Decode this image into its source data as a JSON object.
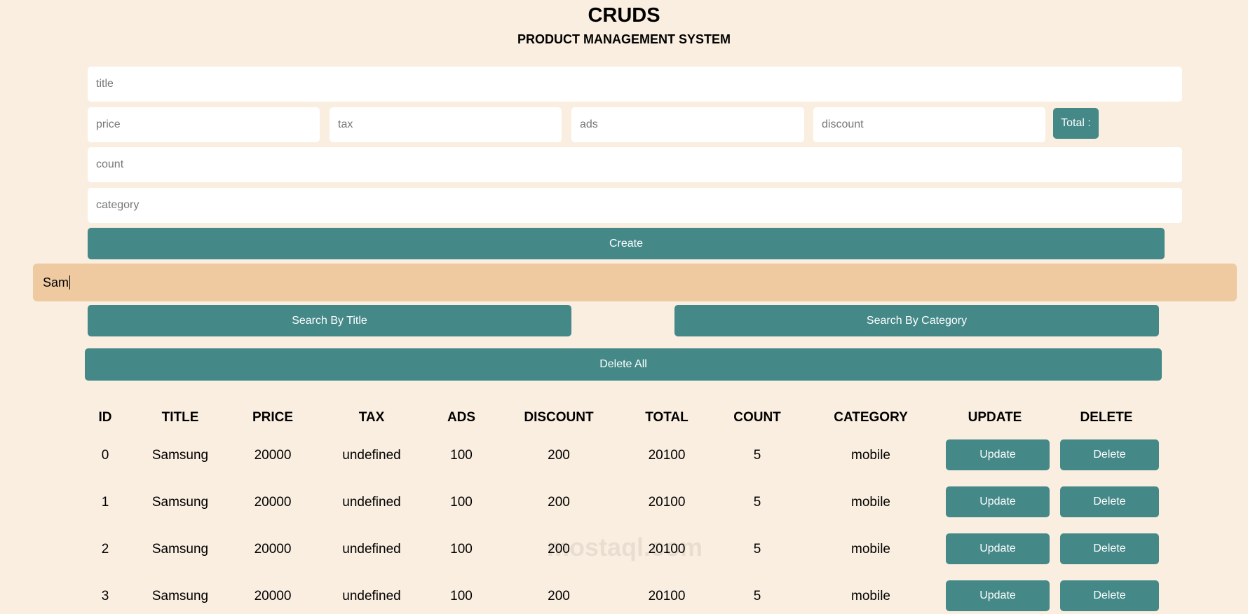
{
  "header": {
    "title": "CRUDS",
    "subtitle": "PRODUCT MANAGEMENT SYSTEM"
  },
  "form": {
    "title_placeholder": "title",
    "price_placeholder": "price",
    "tax_placeholder": "tax",
    "ads_placeholder": "ads",
    "discount_placeholder": "discount",
    "total_label": "Total :",
    "count_placeholder": "count",
    "category_placeholder": "category",
    "create_label": "Create"
  },
  "search": {
    "value": "Sam",
    "by_title_label": "Search By Title",
    "by_category_label": "Search By Category"
  },
  "delete_all_label": "Delete All",
  "table": {
    "headers": [
      "ID",
      "TITLE",
      "PRICE",
      "TAX",
      "ADS",
      "DISCOUNT",
      "TOTAL",
      "COUNT",
      "CATEGORY",
      "UPDATE",
      "DELETE"
    ],
    "rows": [
      [
        "0",
        "Samsung",
        "20000",
        "undefined",
        "100",
        "200",
        "20100",
        "5",
        "mobile"
      ],
      [
        "1",
        "Samsung",
        "20000",
        "undefined",
        "100",
        "200",
        "20100",
        "5",
        "mobile"
      ],
      [
        "2",
        "Samsung",
        "20000",
        "undefined",
        "100",
        "200",
        "20100",
        "5",
        "mobile"
      ],
      [
        "3",
        "Samsung",
        "20000",
        "undefined",
        "100",
        "200",
        "20100",
        "5",
        "mobile"
      ]
    ],
    "update_label": "Update",
    "delete_label": "Delete"
  },
  "watermark": "mostaql.com",
  "colors": {
    "background": "#faeee0",
    "accent": "#448888",
    "search_bg": "#efc9a0"
  }
}
